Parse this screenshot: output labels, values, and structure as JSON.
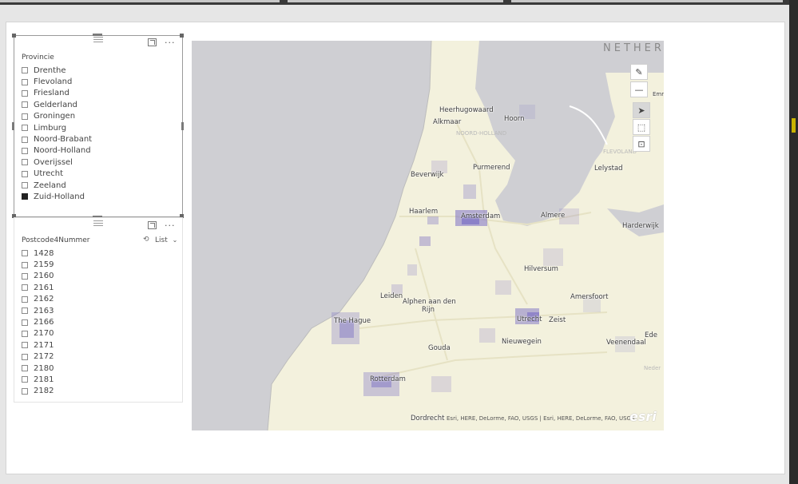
{
  "provincie_slicer": {
    "title": "Provincie",
    "items": [
      {
        "label": "Drenthe",
        "checked": false
      },
      {
        "label": "Flevoland",
        "checked": false
      },
      {
        "label": "Friesland",
        "checked": false
      },
      {
        "label": "Gelderland",
        "checked": false
      },
      {
        "label": "Groningen",
        "checked": false
      },
      {
        "label": "Limburg",
        "checked": false
      },
      {
        "label": "Noord-Brabant",
        "checked": false
      },
      {
        "label": "Noord-Holland",
        "checked": false
      },
      {
        "label": "Overijssel",
        "checked": false
      },
      {
        "label": "Utrecht",
        "checked": false
      },
      {
        "label": "Zeeland",
        "checked": false
      },
      {
        "label": "Zuid-Holland",
        "checked": true
      }
    ],
    "focus_icon": "focus-mode-icon",
    "more_icon": "more-options-icon",
    "more_glyph": "···"
  },
  "postcode_slicer": {
    "title": "Postcode4Nummer",
    "mode_label": "List",
    "items": [
      {
        "label": "1428",
        "checked": false
      },
      {
        "label": "2159",
        "checked": false
      },
      {
        "label": "2160",
        "checked": false
      },
      {
        "label": "2161",
        "checked": false
      },
      {
        "label": "2162",
        "checked": false
      },
      {
        "label": "2163",
        "checked": false
      },
      {
        "label": "2166",
        "checked": false
      },
      {
        "label": "2170",
        "checked": false
      },
      {
        "label": "2171",
        "checked": false
      },
      {
        "label": "2172",
        "checked": false
      },
      {
        "label": "2180",
        "checked": false
      },
      {
        "label": "2181",
        "checked": false
      },
      {
        "label": "2182",
        "checked": false
      }
    ],
    "more_glyph": "···"
  },
  "map": {
    "country_label": "NETHER",
    "city_labels": [
      {
        "name": "Heerhugowaard"
      },
      {
        "name": "Alkmaar"
      },
      {
        "name": "Hoorn"
      },
      {
        "name": "NOORD-HOLLAND"
      },
      {
        "name": "Purmerend"
      },
      {
        "name": "Beverwijk"
      },
      {
        "name": "Lelystad"
      },
      {
        "name": "Haarlem"
      },
      {
        "name": "Amsterdam"
      },
      {
        "name": "Almere"
      },
      {
        "name": "Harderwijk"
      },
      {
        "name": "Hilversum"
      },
      {
        "name": "Leiden"
      },
      {
        "name": "Alphen aan den"
      },
      {
        "name": "Rijn"
      },
      {
        "name": "Amersfoort"
      },
      {
        "name": "The Hague"
      },
      {
        "name": "Utrecht"
      },
      {
        "name": "Zeist"
      },
      {
        "name": "Ede"
      },
      {
        "name": "Nieuwegein"
      },
      {
        "name": "Veenendaal"
      },
      {
        "name": "Gouda"
      },
      {
        "name": "Rotterdam"
      },
      {
        "name": "Dordrecht"
      },
      {
        "name": "Emr"
      },
      {
        "name": "FLEVOLAND"
      },
      {
        "name": "Neder"
      }
    ],
    "attribution": "Esri, HERE, DeLorme, FAO, USGS | Esri, HERE, DeLorme, FAO, USGS",
    "logo": "esri",
    "colors": {
      "land": "#f3f1dd",
      "water": "#cfcfd3",
      "choropleth": "#7b6fc4"
    },
    "tools": [
      {
        "icon": "pencil-icon",
        "active": false
      },
      {
        "icon": "minus-icon",
        "active": false
      },
      {
        "icon": "pointer-select-icon",
        "active": true
      },
      {
        "icon": "rectangle-select-icon",
        "active": false
      },
      {
        "icon": "lasso-select-icon",
        "active": false
      }
    ]
  }
}
